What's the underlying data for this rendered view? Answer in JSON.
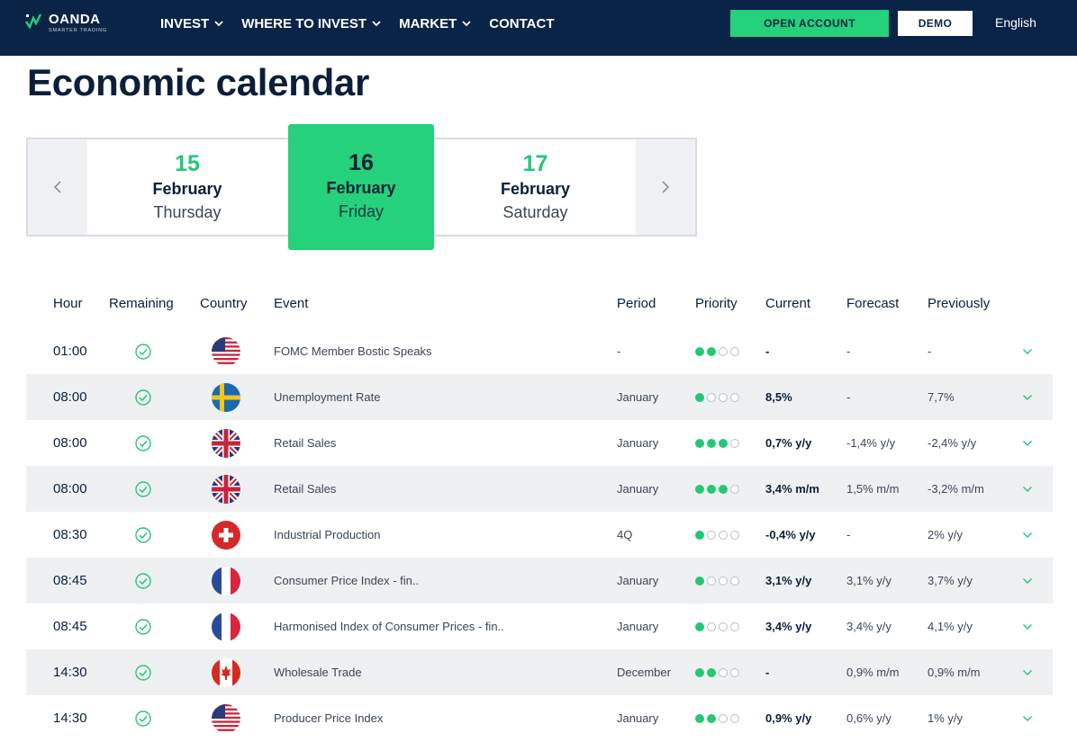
{
  "header": {
    "logo_name": "OANDA",
    "logo_tagline": "SMARTER TRADING",
    "nav": [
      {
        "label": "INVEST",
        "dropdown": true
      },
      {
        "label": "WHERE TO INVEST",
        "dropdown": true
      },
      {
        "label": "MARKET",
        "dropdown": true
      },
      {
        "label": "CONTACT",
        "dropdown": false
      }
    ],
    "open_account_label": "OPEN ACCOUNT",
    "demo_label": "DEMO",
    "language": "English"
  },
  "page_title": "Economic calendar",
  "dates": [
    {
      "day": "15",
      "month": "February",
      "weekday": "Thursday",
      "active": false
    },
    {
      "day": "16",
      "month": "February",
      "weekday": "Friday",
      "active": true
    },
    {
      "day": "17",
      "month": "February",
      "weekday": "Saturday",
      "active": false
    }
  ],
  "table": {
    "columns": {
      "hour": "Hour",
      "remaining": "Remaining",
      "country": "Country",
      "event": "Event",
      "period": "Period",
      "priority": "Priority",
      "current": "Current",
      "forecast": "Forecast",
      "previously": "Previously"
    },
    "rows": [
      {
        "hour": "01:00",
        "flag": "us-flag",
        "event": "FOMC Member Bostic Speaks",
        "period": "-",
        "priority": 2,
        "current": "-",
        "forecast": "-",
        "previously": "-"
      },
      {
        "hour": "08:00",
        "flag": "se-flag",
        "event": "Unemployment Rate",
        "period": "January",
        "priority": 1,
        "current": "8,5%",
        "forecast": "-",
        "previously": "7,7%"
      },
      {
        "hour": "08:00",
        "flag": "uk-flag",
        "event": "Retail Sales",
        "period": "January",
        "priority": 3,
        "current": "0,7% y/y",
        "forecast": "-1,4% y/y",
        "previously": "-2,4% y/y"
      },
      {
        "hour": "08:00",
        "flag": "uk-flag",
        "event": "Retail Sales",
        "period": "January",
        "priority": 3,
        "current": "3,4% m/m",
        "forecast": "1,5% m/m",
        "previously": "-3,2% m/m"
      },
      {
        "hour": "08:30",
        "flag": "ch-flag",
        "event": "Industrial Production",
        "period": "4Q",
        "priority": 1,
        "current": "-0,4% y/y",
        "forecast": "-",
        "previously": "2% y/y"
      },
      {
        "hour": "08:45",
        "flag": "fr-flag",
        "event": "Consumer Price Index - fin..",
        "period": "January",
        "priority": 1,
        "current": "3,1% y/y",
        "forecast": "3,1% y/y",
        "previously": "3,7% y/y"
      },
      {
        "hour": "08:45",
        "flag": "fr-flag",
        "event": "Harmonised Index of Consumer Prices - fin..",
        "period": "January",
        "priority": 1,
        "current": "3,4% y/y",
        "forecast": "3,4% y/y",
        "previously": "4,1% y/y"
      },
      {
        "hour": "14:30",
        "flag": "ca-flag",
        "event": "Wholesale Trade",
        "period": "December",
        "priority": 2,
        "current": "-",
        "forecast": "0,9% m/m",
        "previously": "0,9% m/m"
      },
      {
        "hour": "14:30",
        "flag": "us-flag",
        "event": "Producer Price Index",
        "period": "January",
        "priority": 2,
        "current": "0,9% y/y",
        "forecast": "0,6% y/y",
        "previously": "1% y/y"
      }
    ]
  },
  "colors": {
    "navy": "#0a2447",
    "green": "#25d17a",
    "row_alt": "#eff0f2"
  }
}
